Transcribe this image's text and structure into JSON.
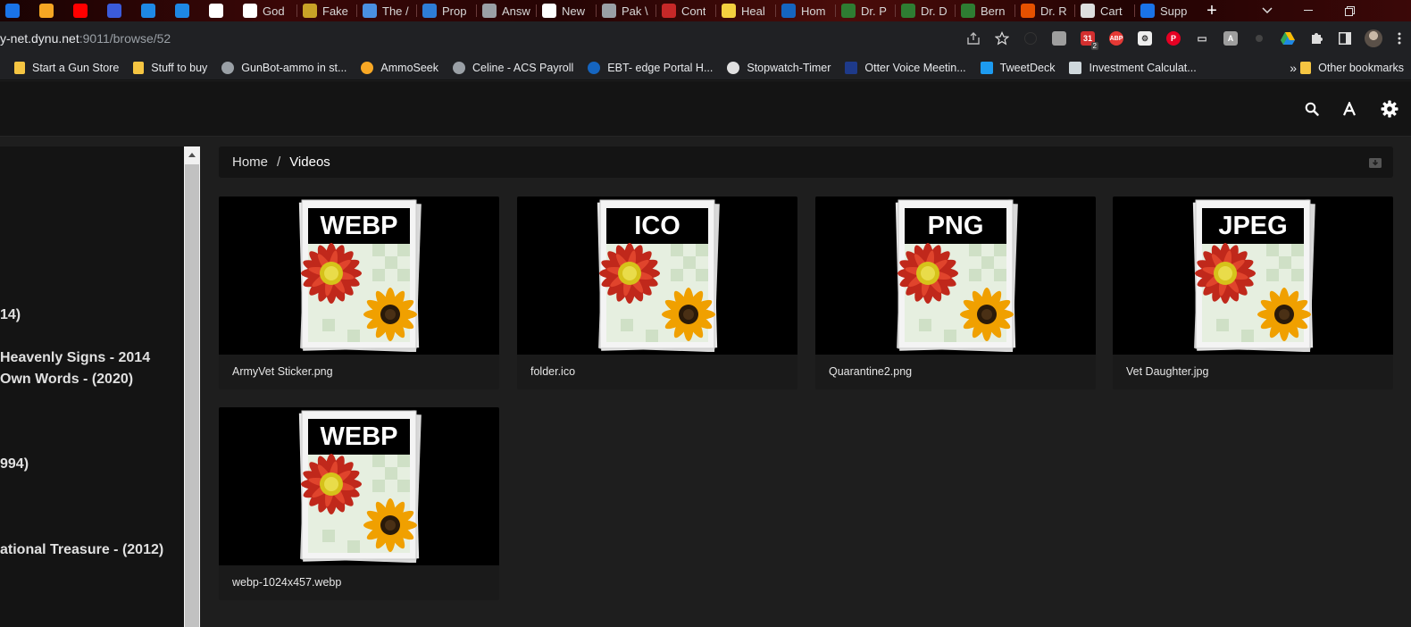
{
  "browser": {
    "tabs": [
      {
        "label": "",
        "icon": "settings-tab-icon",
        "color": "#1a73e8"
      },
      {
        "label": "",
        "icon": "cloud-tab-icon",
        "color": "#f5a623"
      },
      {
        "label": "",
        "icon": "youtube-tab-icon",
        "color": "#ff0000"
      },
      {
        "label": "",
        "icon": "m-tab-icon",
        "color": "#3b5bdb"
      },
      {
        "label": "",
        "icon": "music-tab-icon",
        "color": "#1e88e5"
      },
      {
        "label": "",
        "icon": "z-tab-icon",
        "color": "#1e88e5"
      },
      {
        "label": "",
        "icon": "google-tab-icon",
        "color": "#ffffff"
      },
      {
        "label": "God",
        "icon": "wiki-tab-icon",
        "color": "#ffffff"
      },
      {
        "label": "Fake",
        "icon": "coin-tab-icon",
        "color": "#c9a227"
      },
      {
        "label": "The /",
        "icon": "hand-tab-icon",
        "color": "#4a90e2"
      },
      {
        "label": "Prop",
        "icon": "image-tab-icon",
        "color": "#2e7dd7"
      },
      {
        "label": "Answ",
        "icon": "globe-tab-icon",
        "color": "#9aa0a6"
      },
      {
        "label": "New",
        "icon": "u-tab-icon",
        "color": "#ffffff"
      },
      {
        "label": "Pak \\",
        "icon": "globe-tab-icon",
        "color": "#9aa0a6"
      },
      {
        "label": "Cont",
        "icon": "lips-tab-icon",
        "color": "#c62828"
      },
      {
        "label": "Heal",
        "icon": "circle-tab-icon",
        "color": "#f4d03f"
      },
      {
        "label": "Hom",
        "icon": "chart-tab-icon",
        "color": "#1565c0"
      },
      {
        "label": "Dr. P",
        "icon": "leaf-tab-icon",
        "color": "#2e7d32"
      },
      {
        "label": "Dr. D",
        "icon": "leaf-tab-icon",
        "color": "#2e7d32"
      },
      {
        "label": "Bern",
        "icon": "leaf-tab-icon",
        "color": "#2e7d32"
      },
      {
        "label": "Dr. R",
        "icon": "book-tab-icon",
        "color": "#e65100"
      },
      {
        "label": "Cart",
        "icon": "cart-tab-icon",
        "color": "#dddddd"
      },
      {
        "label": "Supp",
        "icon": "settings-tab-icon",
        "color": "#1a73e8"
      }
    ],
    "new_tab": "+",
    "url_host": "y-net.dynu.net",
    "url_path": ":9011/browse/52",
    "bookmarks": [
      {
        "label": "Start a Gun Store",
        "icon": "folder-icon"
      },
      {
        "label": "Stuff to buy",
        "icon": "folder-icon"
      },
      {
        "label": "GunBot-ammo in st...",
        "icon": "globe-icon"
      },
      {
        "label": "AmmoSeek",
        "icon": "ammoseek-icon"
      },
      {
        "label": "Celine - ACS Payroll",
        "icon": "globe-icon"
      },
      {
        "label": "EBT- edge Portal H...",
        "icon": "ebt-icon"
      },
      {
        "label": "Stopwatch-Timer",
        "icon": "stopwatch-icon"
      },
      {
        "label": "Otter Voice Meetin...",
        "icon": "otter-icon"
      },
      {
        "label": "TweetDeck",
        "icon": "twitter-icon"
      },
      {
        "label": "Investment Calculat...",
        "icon": "calculator-icon"
      }
    ],
    "bookmarks_more": "»",
    "other_bookmarks": "Other bookmarks",
    "extension_badge": "2"
  },
  "sidebar": {
    "items": [
      {
        "label": "14)"
      },
      {
        "label": "Heavenly Signs - 2014"
      },
      {
        "label": "Own Words - (2020)"
      },
      {
        "label": "994)"
      },
      {
        "label": "ational Treasure - (2012)"
      }
    ]
  },
  "breadcrumb": {
    "home": "Home",
    "separator": "/",
    "current": "Videos"
  },
  "files": [
    {
      "name": "ArmyVet Sticker.png",
      "badge": "WEBP"
    },
    {
      "name": "folder.ico",
      "badge": "ICO"
    },
    {
      "name": "Quarantine2.png",
      "badge": "PNG"
    },
    {
      "name": "Vet Daughter.jpg",
      "badge": "JPEG"
    },
    {
      "name": "webp-1024x457.webp",
      "badge": "WEBP"
    }
  ]
}
